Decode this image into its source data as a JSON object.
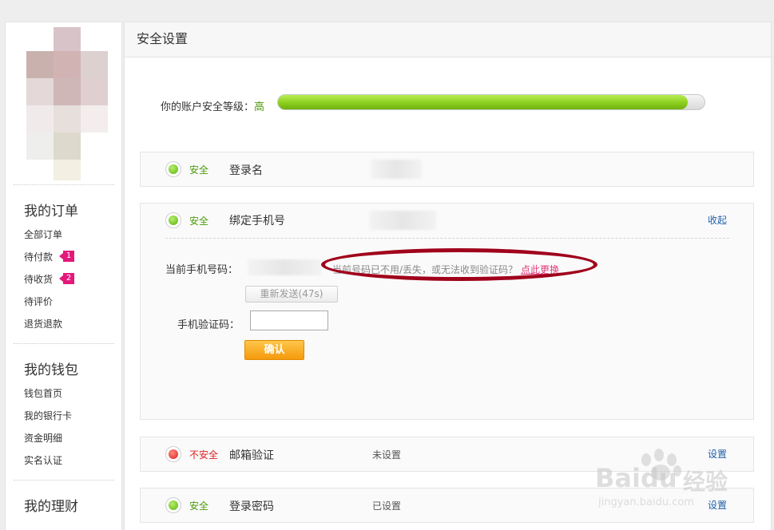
{
  "sidebar": {
    "sections": [
      {
        "title": "我的订单",
        "items": [
          {
            "label": "全部订单"
          },
          {
            "label": "待付款",
            "badge": "1"
          },
          {
            "label": "待收货",
            "badge": "2"
          },
          {
            "label": "待评价"
          },
          {
            "label": "退货退款"
          }
        ]
      },
      {
        "title": "我的钱包",
        "items": [
          {
            "label": "钱包首页"
          },
          {
            "label": "我的银行卡"
          },
          {
            "label": "资金明细"
          },
          {
            "label": "实名认证"
          }
        ]
      },
      {
        "title": "我的理财",
        "items": []
      }
    ]
  },
  "main": {
    "title": "安全设置",
    "security_level": {
      "label": "你的账户安全等级：",
      "value": "高",
      "progress": 0.96
    },
    "items": [
      {
        "status": "安全",
        "name": "登录名",
        "value": ""
      },
      {
        "status": "安全",
        "name": "绑定手机号",
        "value": "",
        "action": "收起"
      },
      {
        "status": "不安全",
        "name": "邮箱验证",
        "value": "未设置",
        "action": "设置"
      },
      {
        "status": "安全",
        "name": "登录密码",
        "value": "已设置",
        "action": "设置"
      }
    ],
    "phone_form": {
      "current_label": "当前手机号码：",
      "hint": "当前号码已不用/丢失，或无法收到验证码？",
      "hint_link": "点此更换",
      "resend_label": "重新发送(47s)",
      "code_label": "手机验证码：",
      "code_value": "",
      "confirm_label": "确认"
    }
  },
  "watermark": {
    "brand": "Baidu",
    "brand_cn": "经验",
    "url": "jingyan.baidu.com"
  },
  "colors": {
    "safe": "#4d9a0a",
    "unsafe": "#e01f1f",
    "link": "#1f5fa8",
    "badge": "#e4187b",
    "annotation": "#a0001b"
  }
}
